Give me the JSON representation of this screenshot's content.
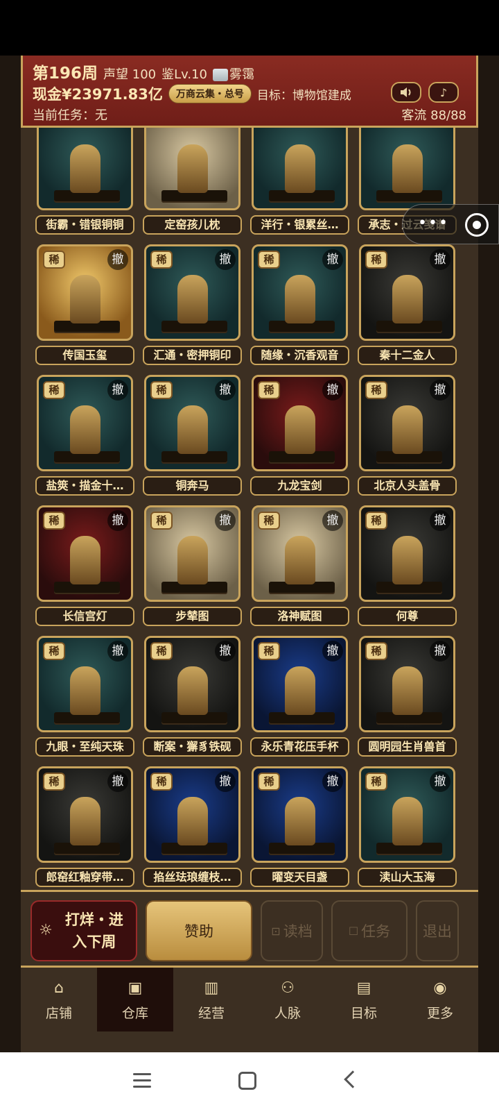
{
  "header": {
    "week": "第196周",
    "reputation": "声望 100",
    "appraisal": "鉴Lv.10",
    "weather": "雾霭",
    "cash": "现金¥23971.83亿",
    "badge": "万商云集・总号",
    "goal": "目标：博物馆建成",
    "task": "当前任务：无",
    "traffic": "客流 88/88",
    "sound_icon": "speaker-icon",
    "music_icon": "music-note-icon"
  },
  "items": {
    "rare_label": "稀",
    "withdraw_label": "撤",
    "rows": [
      [
        "街霸・错银铜铜",
        "定窑孩儿枕",
        "洋行・银累丝…",
        "承志・过云笺谱"
      ],
      [
        "传国玉玺",
        "汇通・密押铜印",
        "随缘・沉香观音",
        "秦十二金人"
      ],
      [
        "盐筴・描金十…",
        "铜奔马",
        "九龙宝剑",
        "北京人头盖骨"
      ],
      [
        "长信宫灯",
        "步辇图",
        "洛神赋图",
        "何尊"
      ],
      [
        "九眼・至纯天珠",
        "断案・獬豸铁砚",
        "永乐青花压手杯",
        "圆明园生肖兽首"
      ],
      [
        "郎窑红釉穿带…",
        "掐丝珐琅缠枝…",
        "曜变天目盏",
        "渎山大玉海"
      ]
    ]
  },
  "actions": {
    "close_week": "打烊・进入下周",
    "sponsor": "赞助",
    "load": "读档",
    "task": "任务",
    "exit": "退出"
  },
  "nav": [
    {
      "label": "店铺",
      "icon": "shop-icon"
    },
    {
      "label": "仓库",
      "icon": "warehouse-icon"
    },
    {
      "label": "经营",
      "icon": "abacus-icon"
    },
    {
      "label": "人脉",
      "icon": "people-icon"
    },
    {
      "label": "目标",
      "icon": "scroll-icon"
    },
    {
      "label": "更多",
      "icon": "more-icon"
    }
  ]
}
